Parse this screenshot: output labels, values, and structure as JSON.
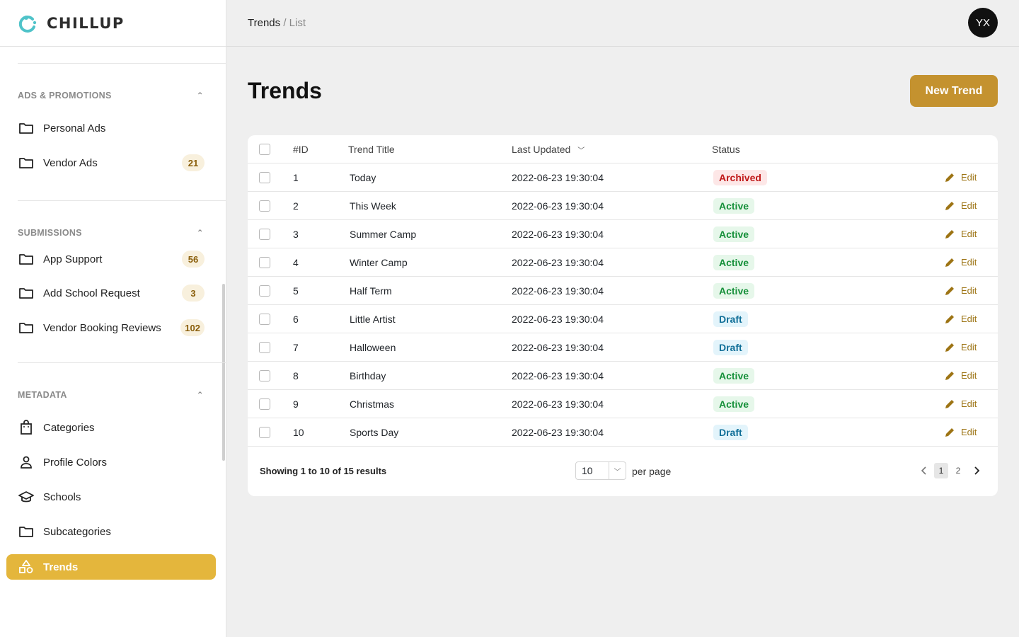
{
  "app": {
    "brand": "CHILLUP",
    "colors": {
      "accent": "#e4b63c",
      "primary_button": "#c4922f",
      "brand_teal": "#4fc3c9"
    }
  },
  "topbar": {
    "breadcrumb_current": "Trends",
    "breadcrumb_separator": "/",
    "breadcrumb_sub": "List",
    "avatar_initials": "YX"
  },
  "sidebar": {
    "groups": [
      {
        "title": "ADS & PROMOTIONS",
        "items": [
          {
            "label": "Personal Ads",
            "icon": "folder-icon"
          },
          {
            "label": "Vendor Ads",
            "icon": "folder-icon",
            "badge": "21"
          }
        ]
      },
      {
        "title": "SUBMISSIONS",
        "items": [
          {
            "label": "App Support",
            "icon": "folder-icon",
            "badge": "56"
          },
          {
            "label": "Add School Request",
            "icon": "folder-icon",
            "badge": "3"
          },
          {
            "label": "Vendor Booking Reviews",
            "icon": "folder-icon",
            "badge": "102"
          }
        ]
      },
      {
        "title": "METADATA",
        "items": [
          {
            "label": "Categories",
            "icon": "shopping-bag-icon"
          },
          {
            "label": "Profile Colors",
            "icon": "user-icon"
          },
          {
            "label": "Schools",
            "icon": "graduation-cap-icon"
          },
          {
            "label": "Subcategories",
            "icon": "folder-icon"
          },
          {
            "label": "Trends",
            "icon": "shapes-icon",
            "active": true
          }
        ]
      }
    ]
  },
  "main": {
    "title": "Trends",
    "new_button": "New Trend",
    "table": {
      "headers": {
        "id": "#ID",
        "title": "Trend Title",
        "updated": "Last Updated",
        "status": "Status"
      },
      "edit_label": "Edit",
      "rows": [
        {
          "id": "1",
          "title": "Today",
          "updated": "2022-06-23 19:30:04",
          "status": "Archived"
        },
        {
          "id": "2",
          "title": "This Week",
          "updated": "2022-06-23 19:30:04",
          "status": "Active"
        },
        {
          "id": "3",
          "title": "Summer Camp",
          "updated": "2022-06-23 19:30:04",
          "status": "Active"
        },
        {
          "id": "4",
          "title": "Winter Camp",
          "updated": "2022-06-23 19:30:04",
          "status": "Active"
        },
        {
          "id": "5",
          "title": "Half Term",
          "updated": "2022-06-23 19:30:04",
          "status": "Active"
        },
        {
          "id": "6",
          "title": "Little Artist",
          "updated": "2022-06-23 19:30:04",
          "status": "Draft"
        },
        {
          "id": "7",
          "title": "Halloween",
          "updated": "2022-06-23 19:30:04",
          "status": "Draft"
        },
        {
          "id": "8",
          "title": "Birthday",
          "updated": "2022-06-23 19:30:04",
          "status": "Active"
        },
        {
          "id": "9",
          "title": "Christmas",
          "updated": "2022-06-23 19:30:04",
          "status": "Active"
        },
        {
          "id": "10",
          "title": "Sports Day",
          "updated": "2022-06-23 19:30:04",
          "status": "Draft"
        }
      ]
    },
    "footer": {
      "results_text": "Showing 1 to 10 of 15 results",
      "per_page_value": "10",
      "per_page_label": "per page",
      "pages": [
        "1",
        "2"
      ],
      "current_page": "1"
    }
  }
}
